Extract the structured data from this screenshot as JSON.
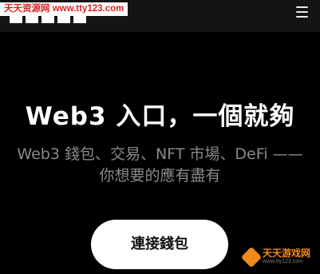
{
  "watermark_top": "天天资源网 www.tty123.com",
  "header": {
    "menu_icon": "hamburger-menu-icon"
  },
  "hero": {
    "title": "Web3 入口，一個就夠",
    "subtitle": "Web3 錢包、交易、NFT 市場、DeFi —— 你想要的應有盡有",
    "connect_button_label": "連接錢包"
  },
  "watermark_bottom": {
    "name": "天天游戏网",
    "url": "www.tty123.com"
  },
  "colors": {
    "background": "#000000",
    "topbar": "#141414",
    "title": "#ffffff",
    "subtitle": "#8a8a8a",
    "button_bg": "#ffffff",
    "button_text": "#111111",
    "watermark_red": "#e02020",
    "watermark_orange": "#f28c1a"
  }
}
